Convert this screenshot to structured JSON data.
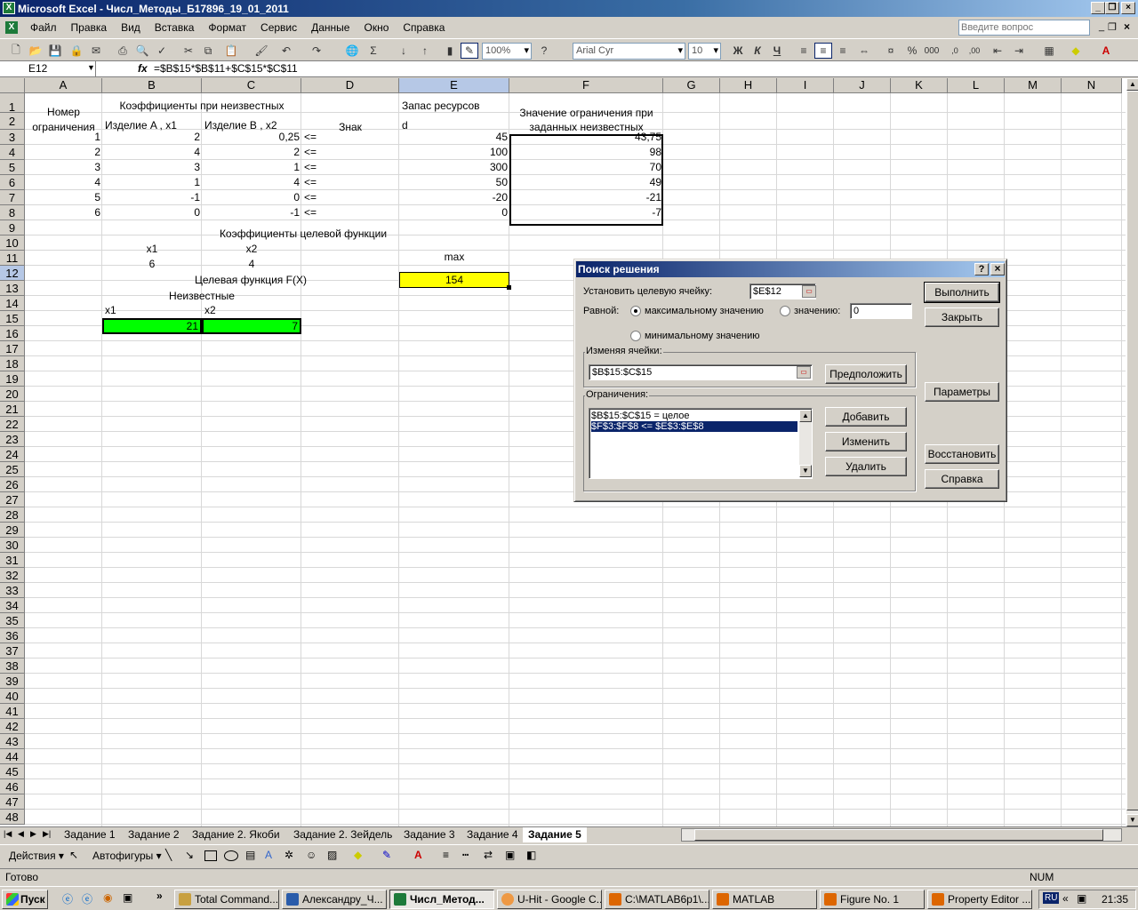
{
  "window": {
    "title": "Microsoft Excel - Числ_Методы_Б17896_19_01_2011"
  },
  "menu": [
    "Файл",
    "Правка",
    "Вид",
    "Вставка",
    "Формат",
    "Сервис",
    "Данные",
    "Окно",
    "Справка"
  ],
  "help_box": {
    "placeholder": "Введите вопрос"
  },
  "toolbar": {
    "zoom": "100%",
    "font": "Arial Cyr",
    "size": "10"
  },
  "formula_bar": {
    "name_box": "E12",
    "fx": "fx",
    "formula": "=$B$15*$B$11+$C$15*$C$11"
  },
  "columns": [
    "A",
    "B",
    "C",
    "D",
    "E",
    "F",
    "G",
    "H",
    "I",
    "J",
    "K",
    "L",
    "M",
    "N"
  ],
  "rows_count": 48,
  "cells": {
    "a1": "Номер",
    "a2": "ограничения",
    "bc1": "Коэффициенты при неизвестных",
    "b2": "Изделие A , x1",
    "c2": "Изделие B , x2",
    "d2": "Знак",
    "e1": "Запас ресурсов",
    "e2": "d",
    "f1": "Значение ограничения при",
    "f2": "заданных неизвестных",
    "constraints": [
      {
        "n": "1",
        "a": "2",
        "b": "0,25",
        "sign": "<=",
        "d": "45",
        "f": "43,75"
      },
      {
        "n": "2",
        "a": "4",
        "b": "2",
        "sign": "<=",
        "d": "100",
        "f": "98"
      },
      {
        "n": "3",
        "a": "3",
        "b": "1",
        "sign": "<=",
        "d": "300",
        "f": "70"
      },
      {
        "n": "4",
        "a": "1",
        "b": "4",
        "sign": "<=",
        "d": "50",
        "f": "49"
      },
      {
        "n": "5",
        "a": "-1",
        "b": "0",
        "sign": "<=",
        "d": "-20",
        "f": "-21"
      },
      {
        "n": "6",
        "a": "0",
        "b": "-1",
        "sign": "<=",
        "d": "0",
        "f": "-7"
      }
    ],
    "r9": "Коэффициенты целевой функции",
    "b10": "x1",
    "c10": "x2",
    "b11": "6",
    "c11": "4",
    "e11": "max",
    "r12": "Целевая функция F(X)",
    "e12": "154",
    "r13": "Неизвестные",
    "b14": "x1",
    "c14": "x2",
    "b15": "21",
    "c15": "7"
  },
  "sheets": [
    "Задание 1",
    "Задание 2",
    "Задание 2. Якоби",
    "Задание 2. Зейдель",
    "Задание 3",
    "Задание 4",
    "Задание 5"
  ],
  "drawing": {
    "actions": "Действия",
    "autoshapes": "Автофигуры"
  },
  "status": {
    "ready": "Готово",
    "num": "NUM"
  },
  "dialog": {
    "title": "Поиск решения",
    "help_q": "?",
    "target_label": "Установить целевую ячейку:",
    "target_value": "$E$12",
    "equal_label": "Равной:",
    "opt_max": "максимальному значению",
    "opt_value": "значению:",
    "value_field": "0",
    "opt_min": "минимальному значению",
    "changing_label": "Изменяя ячейки:",
    "changing_value": "$B$15:$C$15",
    "guess_btn": "Предположить",
    "constraints_label": "Ограничения:",
    "constraints": [
      "$B$15:$C$15 = целое",
      "$F$3:$F$8 <= $E$3:$E$8"
    ],
    "add_btn": "Добавить",
    "change_btn": "Изменить",
    "delete_btn": "Удалить",
    "solve_btn": "Выполнить",
    "close_btn": "Закрыть",
    "options_btn": "Параметры",
    "reset_btn": "Восстановить",
    "help_btn": "Справка"
  },
  "taskbar": {
    "start": "Пуск",
    "items": [
      "Total Command...",
      "Александру_Ч...",
      "Числ_Метод...",
      "U-Hit - Google C...",
      "C:\\MATLAB6p1\\...",
      "MATLAB",
      "Figure No. 1",
      "Property Editor ..."
    ],
    "lang": "RU",
    "clock": "21:35"
  }
}
